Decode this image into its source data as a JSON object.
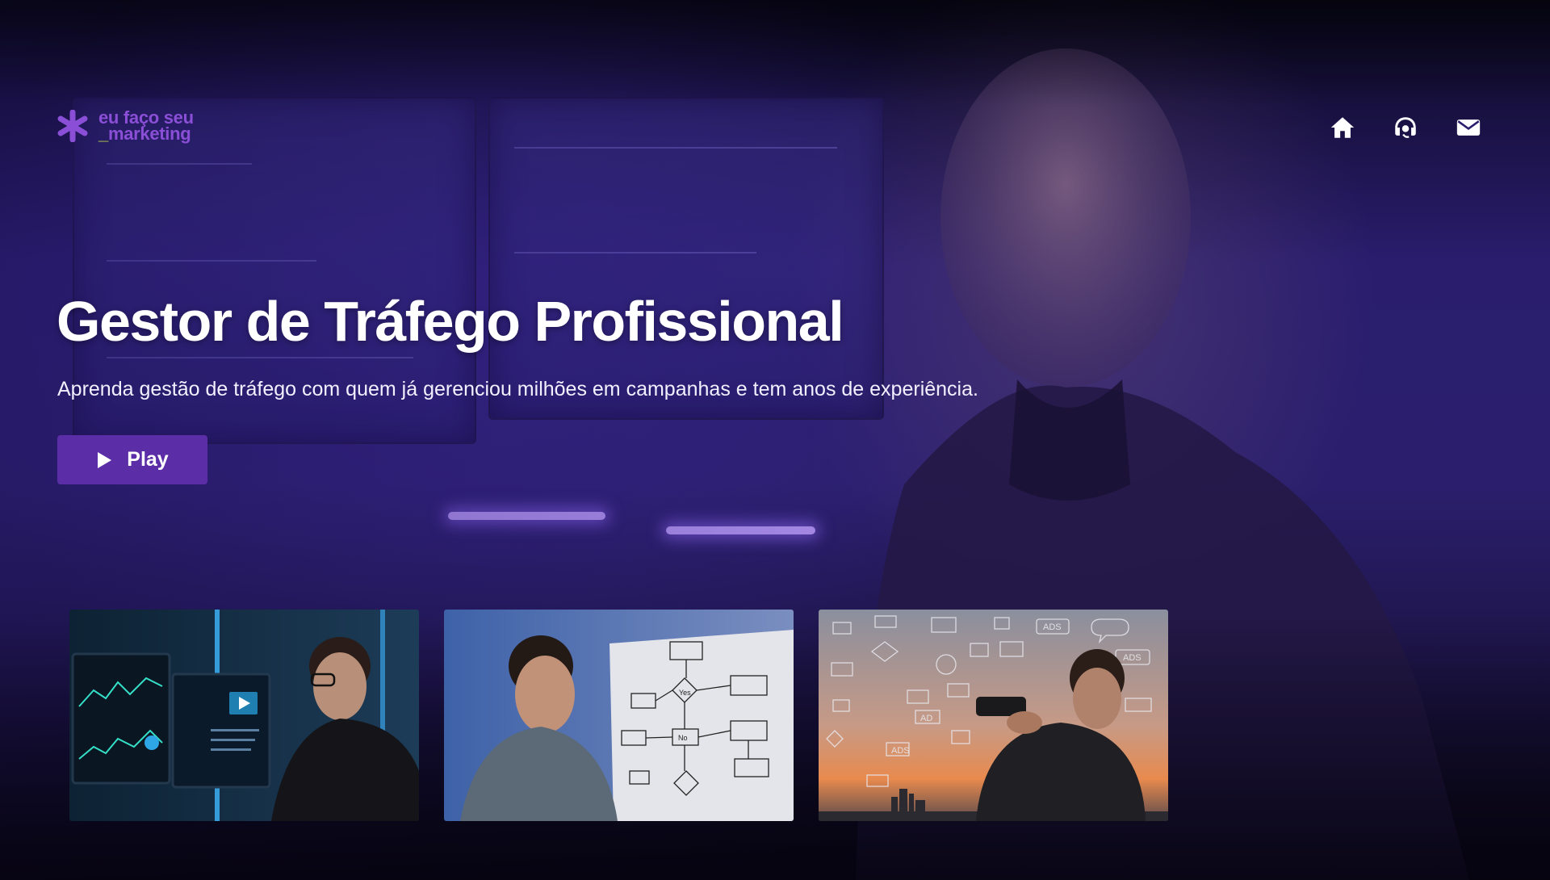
{
  "brand": {
    "logo_line1": "eu faço seu",
    "logo_line2_prefix": "_",
    "logo_line2": "marketing",
    "logo_color": "#8a4fd6",
    "logo_accent": "#b9d34a"
  },
  "nav": {
    "icons": [
      "home-icon",
      "support-headset-icon",
      "mail-icon"
    ]
  },
  "hero": {
    "title": "Gestor de Tráfego Profissional",
    "subtitle": "Aprenda gestão de tráfego com quem já gerenciou milhões em campanhas e tem anos de experiência.",
    "play_label": "Play",
    "play_color": "#5b2ea8"
  },
  "thumbnails": [
    {
      "name": "thumbnail-analytics-monitors"
    },
    {
      "name": "thumbnail-flowchart-whiteboard",
      "labels": {
        "yes": "Yes",
        "no": "No"
      }
    },
    {
      "name": "thumbnail-binoculars-ads",
      "labels": {
        "ads": "ADS",
        "ad": "AD"
      }
    }
  ]
}
